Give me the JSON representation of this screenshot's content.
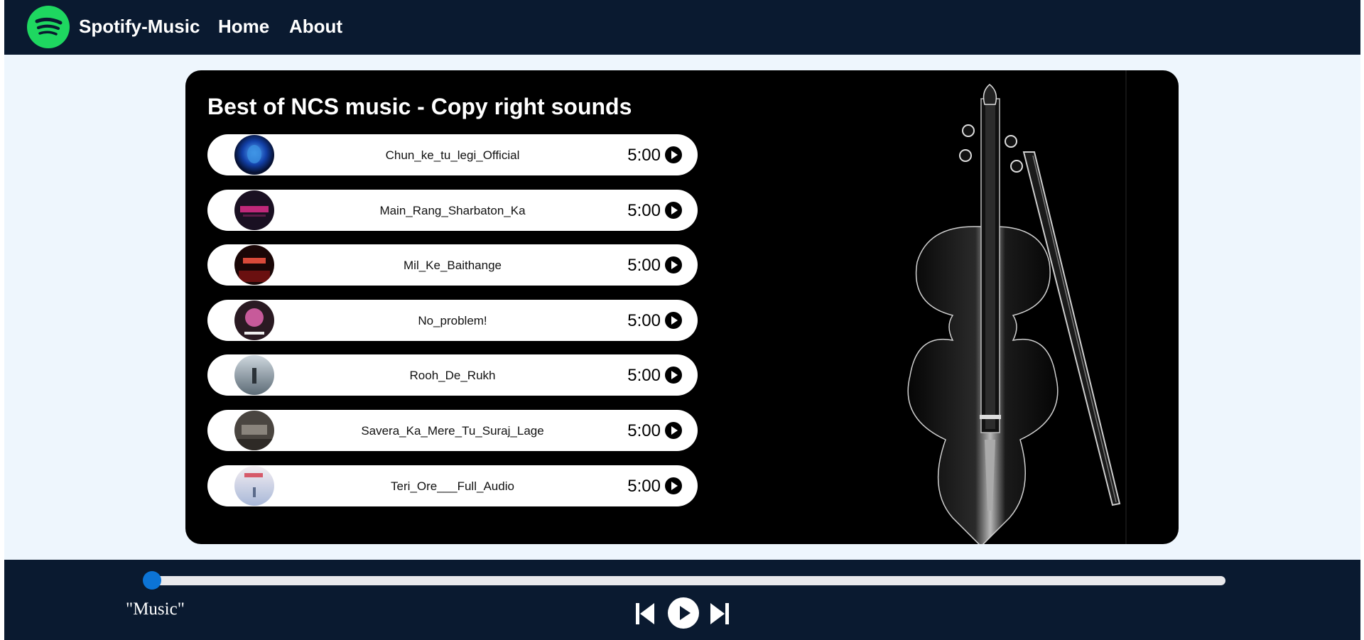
{
  "nav": {
    "brand": "Spotify-Music",
    "links": [
      "Home",
      "About"
    ],
    "logo_icon": "spotify-logo-icon",
    "background": "#0a1a30",
    "logo_color": "#1ed760"
  },
  "playlist": {
    "title": "Best of NCS music - Copy right sounds",
    "songs": [
      {
        "name": "Chun_ke_tu_legi_Official",
        "duration": "5:00"
      },
      {
        "name": "Main_Rang_Sharbaton_Ka",
        "duration": "5:00"
      },
      {
        "name": "Mil_Ke_Baithange",
        "duration": "5:00"
      },
      {
        "name": "No_problem!",
        "duration": "5:00"
      },
      {
        "name": "Rooh_De_Rukh",
        "duration": "5:00"
      },
      {
        "name": "Savera_Ka_Mere_Tu_Suraj_Lage",
        "duration": "5:00"
      },
      {
        "name": "Teri_Ore___Full_Audio",
        "duration": "5:00"
      }
    ]
  },
  "player": {
    "now_playing": "\"Music\"",
    "progress": 0,
    "accent": "#0c74d6",
    "controls": [
      "previous-icon",
      "play-icon",
      "next-icon"
    ]
  }
}
